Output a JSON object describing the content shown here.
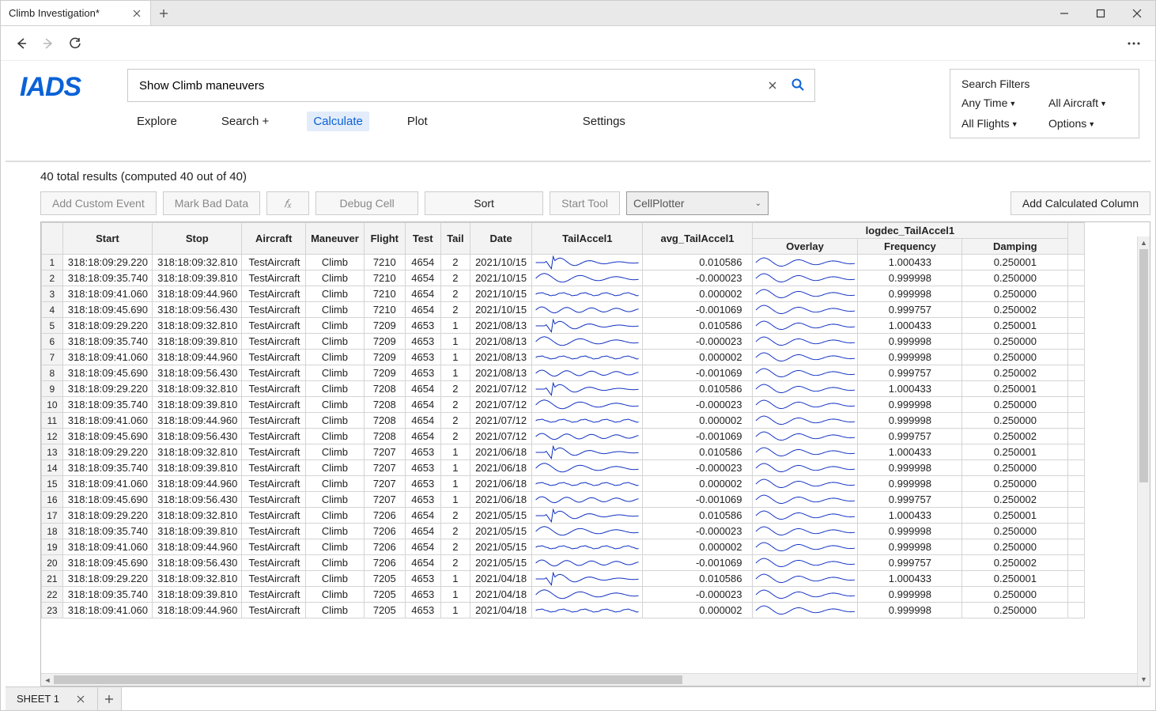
{
  "window": {
    "title": "Climb Investigation*"
  },
  "logo": "IADS",
  "search": {
    "value": "Show Climb maneuvers"
  },
  "menu": {
    "explore": "Explore",
    "search": "Search +",
    "calculate": "Calculate",
    "plot": "Plot",
    "settings": "Settings"
  },
  "filters": {
    "title": "Search Filters",
    "time": "Any Time",
    "aircraft": "All Aircraft",
    "flights": "All Flights",
    "options": "Options"
  },
  "results_caption": "40 total results (computed 40 out of 40)",
  "toolbar": {
    "add_event": "Add Custom Event",
    "mark_bad": "Mark Bad Data",
    "fx": "𝑓ₓ",
    "debug": "Debug Cell",
    "sort": "Sort",
    "start_tool": "Start Tool",
    "tool_selected": "CellPlotter",
    "add_col": "Add Calculated Column"
  },
  "table": {
    "group_header": "logdec_TailAccel1",
    "headers": {
      "start": "Start",
      "stop": "Stop",
      "aircraft": "Aircraft",
      "maneuver": "Maneuver",
      "flight": "Flight",
      "test": "Test",
      "tail": "Tail",
      "date": "Date",
      "tailaccel": "TailAccel1",
      "avg": "avg_TailAccel1",
      "overlay": "Overlay",
      "freq": "Frequency",
      "damp": "Damping"
    },
    "rows": [
      {
        "n": 1,
        "start": "318:18:09:29.220",
        "stop": "318:18:09:32.810",
        "ac": "TestAircraft",
        "man": "Climb",
        "fl": "7210",
        "test": "4654",
        "tail": "2",
        "date": "2021/10/15",
        "avg": "0.010586",
        "freq": "1.000433",
        "damp": "0.250001"
      },
      {
        "n": 2,
        "start": "318:18:09:35.740",
        "stop": "318:18:09:39.810",
        "ac": "TestAircraft",
        "man": "Climb",
        "fl": "7210",
        "test": "4654",
        "tail": "2",
        "date": "2021/10/15",
        "avg": "-0.000023",
        "freq": "0.999998",
        "damp": "0.250000"
      },
      {
        "n": 3,
        "start": "318:18:09:41.060",
        "stop": "318:18:09:44.960",
        "ac": "TestAircraft",
        "man": "Climb",
        "fl": "7210",
        "test": "4654",
        "tail": "2",
        "date": "2021/10/15",
        "avg": "0.000002",
        "freq": "0.999998",
        "damp": "0.250000"
      },
      {
        "n": 4,
        "start": "318:18:09:45.690",
        "stop": "318:18:09:56.430",
        "ac": "TestAircraft",
        "man": "Climb",
        "fl": "7210",
        "test": "4654",
        "tail": "2",
        "date": "2021/10/15",
        "avg": "-0.001069",
        "freq": "0.999757",
        "damp": "0.250002"
      },
      {
        "n": 5,
        "start": "318:18:09:29.220",
        "stop": "318:18:09:32.810",
        "ac": "TestAircraft",
        "man": "Climb",
        "fl": "7209",
        "test": "4653",
        "tail": "1",
        "date": "2021/08/13",
        "avg": "0.010586",
        "freq": "1.000433",
        "damp": "0.250001"
      },
      {
        "n": 6,
        "start": "318:18:09:35.740",
        "stop": "318:18:09:39.810",
        "ac": "TestAircraft",
        "man": "Climb",
        "fl": "7209",
        "test": "4653",
        "tail": "1",
        "date": "2021/08/13",
        "avg": "-0.000023",
        "freq": "0.999998",
        "damp": "0.250000"
      },
      {
        "n": 7,
        "start": "318:18:09:41.060",
        "stop": "318:18:09:44.960",
        "ac": "TestAircraft",
        "man": "Climb",
        "fl": "7209",
        "test": "4653",
        "tail": "1",
        "date": "2021/08/13",
        "avg": "0.000002",
        "freq": "0.999998",
        "damp": "0.250000"
      },
      {
        "n": 8,
        "start": "318:18:09:45.690",
        "stop": "318:18:09:56.430",
        "ac": "TestAircraft",
        "man": "Climb",
        "fl": "7209",
        "test": "4653",
        "tail": "1",
        "date": "2021/08/13",
        "avg": "-0.001069",
        "freq": "0.999757",
        "damp": "0.250002"
      },
      {
        "n": 9,
        "start": "318:18:09:29.220",
        "stop": "318:18:09:32.810",
        "ac": "TestAircraft",
        "man": "Climb",
        "fl": "7208",
        "test": "4654",
        "tail": "2",
        "date": "2021/07/12",
        "avg": "0.010586",
        "freq": "1.000433",
        "damp": "0.250001"
      },
      {
        "n": 10,
        "start": "318:18:09:35.740",
        "stop": "318:18:09:39.810",
        "ac": "TestAircraft",
        "man": "Climb",
        "fl": "7208",
        "test": "4654",
        "tail": "2",
        "date": "2021/07/12",
        "avg": "-0.000023",
        "freq": "0.999998",
        "damp": "0.250000"
      },
      {
        "n": 11,
        "start": "318:18:09:41.060",
        "stop": "318:18:09:44.960",
        "ac": "TestAircraft",
        "man": "Climb",
        "fl": "7208",
        "test": "4654",
        "tail": "2",
        "date": "2021/07/12",
        "avg": "0.000002",
        "freq": "0.999998",
        "damp": "0.250000"
      },
      {
        "n": 12,
        "start": "318:18:09:45.690",
        "stop": "318:18:09:56.430",
        "ac": "TestAircraft",
        "man": "Climb",
        "fl": "7208",
        "test": "4654",
        "tail": "2",
        "date": "2021/07/12",
        "avg": "-0.001069",
        "freq": "0.999757",
        "damp": "0.250002"
      },
      {
        "n": 13,
        "start": "318:18:09:29.220",
        "stop": "318:18:09:32.810",
        "ac": "TestAircraft",
        "man": "Climb",
        "fl": "7207",
        "test": "4653",
        "tail": "1",
        "date": "2021/06/18",
        "avg": "0.010586",
        "freq": "1.000433",
        "damp": "0.250001"
      },
      {
        "n": 14,
        "start": "318:18:09:35.740",
        "stop": "318:18:09:39.810",
        "ac": "TestAircraft",
        "man": "Climb",
        "fl": "7207",
        "test": "4653",
        "tail": "1",
        "date": "2021/06/18",
        "avg": "-0.000023",
        "freq": "0.999998",
        "damp": "0.250000"
      },
      {
        "n": 15,
        "start": "318:18:09:41.060",
        "stop": "318:18:09:44.960",
        "ac": "TestAircraft",
        "man": "Climb",
        "fl": "7207",
        "test": "4653",
        "tail": "1",
        "date": "2021/06/18",
        "avg": "0.000002",
        "freq": "0.999998",
        "damp": "0.250000"
      },
      {
        "n": 16,
        "start": "318:18:09:45.690",
        "stop": "318:18:09:56.430",
        "ac": "TestAircraft",
        "man": "Climb",
        "fl": "7207",
        "test": "4653",
        "tail": "1",
        "date": "2021/06/18",
        "avg": "-0.001069",
        "freq": "0.999757",
        "damp": "0.250002"
      },
      {
        "n": 17,
        "start": "318:18:09:29.220",
        "stop": "318:18:09:32.810",
        "ac": "TestAircraft",
        "man": "Climb",
        "fl": "7206",
        "test": "4654",
        "tail": "2",
        "date": "2021/05/15",
        "avg": "0.010586",
        "freq": "1.000433",
        "damp": "0.250001"
      },
      {
        "n": 18,
        "start": "318:18:09:35.740",
        "stop": "318:18:09:39.810",
        "ac": "TestAircraft",
        "man": "Climb",
        "fl": "7206",
        "test": "4654",
        "tail": "2",
        "date": "2021/05/15",
        "avg": "-0.000023",
        "freq": "0.999998",
        "damp": "0.250000"
      },
      {
        "n": 19,
        "start": "318:18:09:41.060",
        "stop": "318:18:09:44.960",
        "ac": "TestAircraft",
        "man": "Climb",
        "fl": "7206",
        "test": "4654",
        "tail": "2",
        "date": "2021/05/15",
        "avg": "0.000002",
        "freq": "0.999998",
        "damp": "0.250000"
      },
      {
        "n": 20,
        "start": "318:18:09:45.690",
        "stop": "318:18:09:56.430",
        "ac": "TestAircraft",
        "man": "Climb",
        "fl": "7206",
        "test": "4654",
        "tail": "2",
        "date": "2021/05/15",
        "avg": "-0.001069",
        "freq": "0.999757",
        "damp": "0.250002"
      },
      {
        "n": 21,
        "start": "318:18:09:29.220",
        "stop": "318:18:09:32.810",
        "ac": "TestAircraft",
        "man": "Climb",
        "fl": "7205",
        "test": "4653",
        "tail": "1",
        "date": "2021/04/18",
        "avg": "0.010586",
        "freq": "1.000433",
        "damp": "0.250001"
      },
      {
        "n": 22,
        "start": "318:18:09:35.740",
        "stop": "318:18:09:39.810",
        "ac": "TestAircraft",
        "man": "Climb",
        "fl": "7205",
        "test": "4653",
        "tail": "1",
        "date": "2021/04/18",
        "avg": "-0.000023",
        "freq": "0.999998",
        "damp": "0.250000"
      },
      {
        "n": 23,
        "start": "318:18:09:41.060",
        "stop": "318:18:09:44.960",
        "ac": "TestAircraft",
        "man": "Climb",
        "fl": "7205",
        "test": "4653",
        "tail": "1",
        "date": "2021/04/18",
        "avg": "0.000002",
        "freq": "0.999998",
        "damp": "0.250000"
      }
    ]
  },
  "sheet": {
    "name": "SHEET 1"
  }
}
